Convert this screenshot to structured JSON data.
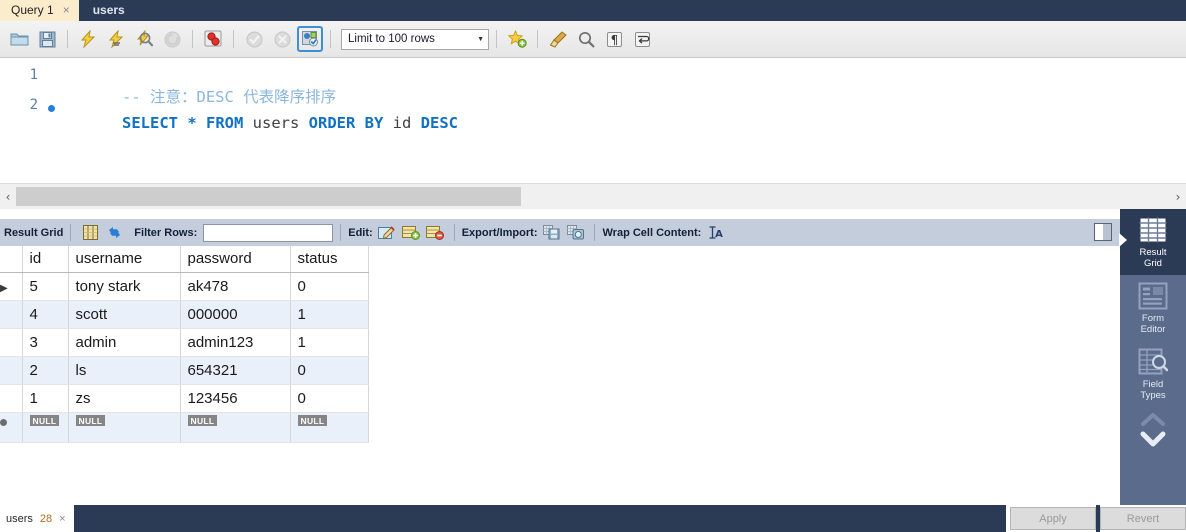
{
  "tabs": {
    "items": [
      {
        "label": "Query 1",
        "active": true,
        "closable": true
      },
      {
        "label": "users",
        "active": false,
        "closable": false
      }
    ],
    "close_glyph": "×"
  },
  "editor_toolbar": {
    "icons": [
      {
        "name": "open-script-icon",
        "title": "Open a script file"
      },
      {
        "name": "save-script-icon",
        "title": "Save script"
      },
      {
        "name": "execute-icon",
        "title": "Execute"
      },
      {
        "name": "execute-current-statement-icon",
        "title": "Execute current statement"
      },
      {
        "name": "explain-icon",
        "title": "Explain"
      },
      {
        "name": "stop-icon",
        "title": "Stop"
      },
      {
        "name": "toggle-stop-on-error-icon",
        "title": "Toggle stop on error"
      },
      {
        "name": "commit-icon",
        "title": "Commit"
      },
      {
        "name": "rollback-icon",
        "title": "Rollback"
      },
      {
        "name": "autocommit-icon",
        "title": "Toggle autocommit"
      },
      {
        "name": "beautify-icon",
        "title": "Beautify query"
      },
      {
        "name": "find-icon",
        "title": "Find"
      },
      {
        "name": "invisible-chars-icon",
        "title": "Toggle invisible characters"
      },
      {
        "name": "wrap-lines-icon",
        "title": "Toggle wrapping"
      }
    ],
    "limit_label": "Limit to 100 rows",
    "limit_caret": "▼"
  },
  "sql": {
    "lines": [
      {
        "number": "1",
        "marker": false,
        "tokens": [
          {
            "text": "-- 注意：DESC 代表降序排序",
            "cls": "cmt"
          }
        ]
      },
      {
        "number": "2",
        "marker": true,
        "tokens": [
          {
            "text": "SELECT * FROM ",
            "cls": "kw"
          },
          {
            "text": "users ",
            "cls": "idf"
          },
          {
            "text": "ORDER BY ",
            "cls": "kw"
          },
          {
            "text": "id ",
            "cls": "idf"
          },
          {
            "text": "DESC",
            "cls": "kw"
          }
        ]
      }
    ]
  },
  "hscroll": {
    "left_arrow": "‹",
    "right_arrow": "›"
  },
  "result_toolbar": {
    "title": "Result Grid",
    "grid_icon": "result-grid-icon",
    "refresh_icon": "refresh-icon",
    "filter_label": "Filter Rows:",
    "filter_value": "",
    "filter_placeholder": "",
    "edit_label": "Edit:",
    "edit_icons": [
      "edit-cell-icon",
      "insert-row-icon",
      "delete-row-icon"
    ],
    "export_label": "Export/Import:",
    "export_icons": [
      "export-recordset-icon",
      "import-recordset-icon"
    ],
    "wrap_label": "Wrap Cell Content:",
    "wrap_icon": "wrap-cell-icon",
    "panel_toggle_icon": "toggle-side-panel-icon"
  },
  "grid": {
    "columns": [
      "id",
      "username",
      "password",
      "status"
    ],
    "rows": [
      {
        "marker": "arrow",
        "cells": [
          "5",
          "tony stark",
          "ak478",
          "0"
        ]
      },
      {
        "marker": "",
        "cells": [
          "4",
          "scott",
          "000000",
          "1"
        ]
      },
      {
        "marker": "",
        "cells": [
          "3",
          "admin",
          "admin123",
          "1"
        ]
      },
      {
        "marker": "",
        "cells": [
          "2",
          "ls",
          "654321",
          "0"
        ]
      },
      {
        "marker": "",
        "cells": [
          "1",
          "zs",
          "123456",
          "0"
        ]
      }
    ],
    "null_row": {
      "marker": "dot",
      "cells": [
        "NULL",
        "NULL",
        "NULL",
        "NULL"
      ]
    }
  },
  "sidebar": {
    "items": [
      {
        "label_line1": "Result",
        "label_line2": "Grid",
        "icon": "result-grid-icon",
        "active": true
      },
      {
        "label_line1": "Form",
        "label_line2": "Editor",
        "icon": "form-editor-icon",
        "active": false
      },
      {
        "label_line1": "Field",
        "label_line2": "Types",
        "icon": "field-types-icon",
        "active": false
      }
    ],
    "scroll_up_icon": "chevron-up-icon",
    "scroll_down_icon": "chevron-down-icon"
  },
  "bottom": {
    "tab_label": "users",
    "tab_count": "28",
    "tab_close": "×",
    "apply_label": "Apply",
    "revert_label": "Revert"
  },
  "colors": {
    "tab_active_bg": "#fbeccc",
    "dark_navy": "#2b3a55",
    "sidebar_bg": "#5a6b8c",
    "result_toolbar_bg": "#c3cddc",
    "alt_row": "#eaf0f9",
    "keyword_blue": "#1172c4",
    "comment_blue": "#8ab6dd"
  }
}
